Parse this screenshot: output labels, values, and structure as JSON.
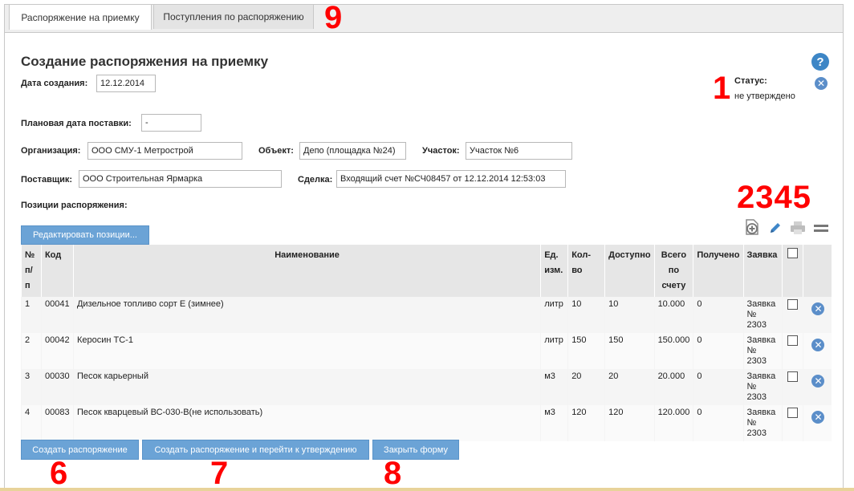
{
  "tabs": [
    {
      "label": "Распоряжение на приемку",
      "active": true
    },
    {
      "label": "Поступления по распоряжению",
      "active": false
    }
  ],
  "page_title": "Создание распоряжения на приемку",
  "creation_date": {
    "label": "Дата создания:",
    "value": "12.12.2014"
  },
  "status": {
    "label": "Статус:",
    "value": "не утверждено"
  },
  "planned_date": {
    "label": "Плановая дата поставки:",
    "value": "-"
  },
  "organization": {
    "label": "Организация:",
    "value": "ООО СМУ-1 Метрострой"
  },
  "object": {
    "label": "Объект:",
    "value": "Депо (площадка №24)"
  },
  "section": {
    "label": "Участок:",
    "value": "Участок №6"
  },
  "supplier": {
    "label": "Поставщик:",
    "value": "ООО Строительная Ярмарка"
  },
  "deal": {
    "label": "Сделка:",
    "value": "Входящий счет №СЧ08457 от 12.12.2014 12:53:03"
  },
  "positions_label": "Позиции распоряжения:",
  "edit_positions_button": "Редактировать позиции...",
  "table": {
    "headers": {
      "num": "№ п/п",
      "code": "Код",
      "name": "Наименование",
      "unit": "Ед. изм.",
      "qty": "Кол-во",
      "available": "Доступно",
      "total": "Всего по счету",
      "received": "Получено",
      "request": "Заявка"
    },
    "rows": [
      {
        "num": "1",
        "code": "00041",
        "name": "Дизельное топливо сорт Е (зимнее)",
        "unit": "литр",
        "qty": "10",
        "available": "10",
        "total": "10.000",
        "received": "0",
        "request": "Заявка № 2303"
      },
      {
        "num": "2",
        "code": "00042",
        "name": "Керосин ТС-1",
        "unit": "литр",
        "qty": "150",
        "available": "150",
        "total": "150.000",
        "received": "0",
        "request": "Заявка № 2303"
      },
      {
        "num": "3",
        "code": "00030",
        "name": "Песок карьерный",
        "unit": "м3",
        "qty": "20",
        "available": "20",
        "total": "20.000",
        "received": "0",
        "request": "Заявка № 2303"
      },
      {
        "num": "4",
        "code": "00083",
        "name": "Песок кварцевый ВС-030-В(не использовать)",
        "unit": "м3",
        "qty": "120",
        "available": "120",
        "total": "120.000",
        "received": "0",
        "request": "Заявка № 2303"
      }
    ]
  },
  "buttons": {
    "create": "Создать распоряжение",
    "create_and_approve": "Создать распоряжение и перейти к утверждению",
    "close": "Закрыть форму"
  },
  "annotations": {
    "n1": "1",
    "n2345": "2345",
    "n6": "6",
    "n7": "7",
    "n8": "8",
    "n9": "9"
  },
  "icons": {
    "help": "help-icon",
    "status_close": "close-circle-icon",
    "add_doc": "add-document-icon",
    "edit": "pencil-icon",
    "print": "printer-icon",
    "menu": "menu-icon",
    "row_delete": "close-circle-icon"
  },
  "colors": {
    "button_bg": "#6ba3d6",
    "annotation": "#ff0000",
    "icon_blue": "#5b8ec9"
  }
}
